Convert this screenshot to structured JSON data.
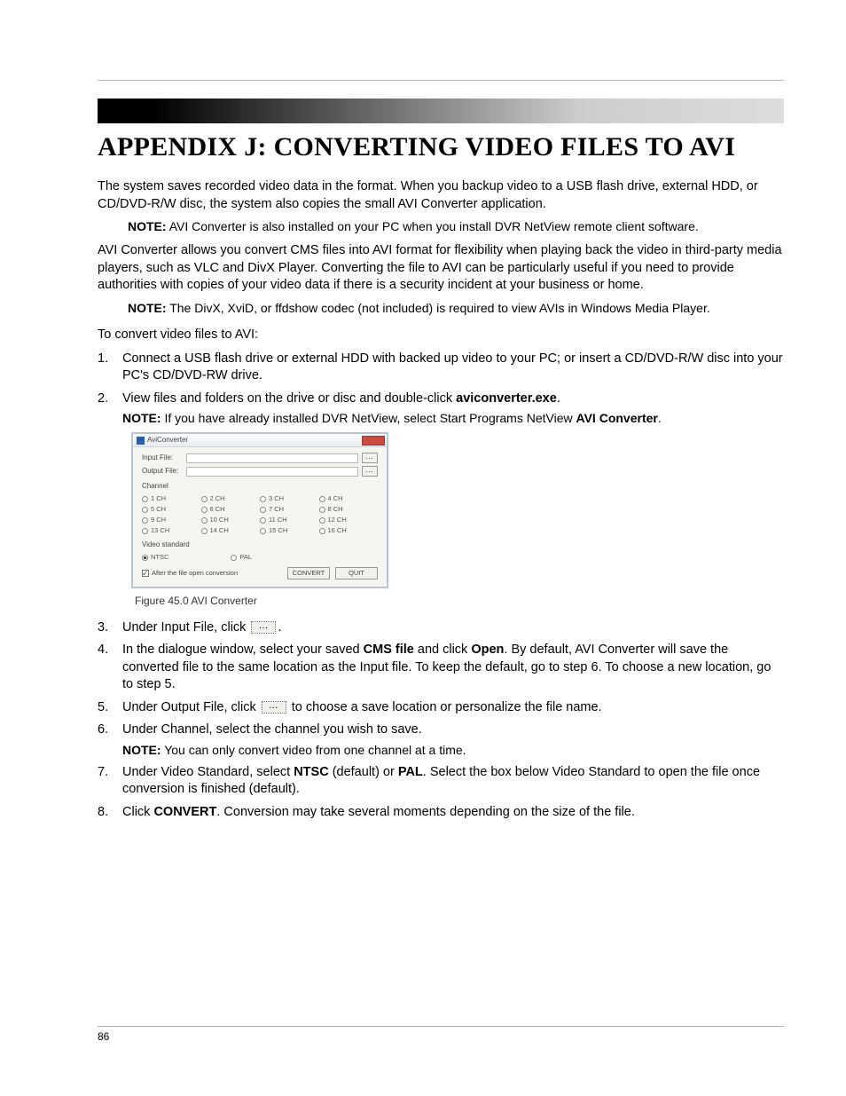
{
  "title": "APPENDIX J: CONVERTING VIDEO FILES TO AVI",
  "intro1": "The system saves recorded video data in the           format. When you backup video to a USB flash drive, external HDD, or CD/DVD-R/W disc, the system also copies the small AVI Converter application.",
  "note1_label": "NOTE:",
  "note1": "AVI Converter is also installed on your PC when you install DVR NetView remote client software.",
  "intro2": "AVI Converter allows you convert CMS files into AVI format for flexibility when playing back the video in third-party media players, such as VLC and DivX Player. Converting the file to AVI can be particularly useful if you need to provide authorities with copies of your video data if there is a security incident at your business or home.",
  "note2_label": "NOTE:",
  "note2": "The DivX, XviD, or ffdshow codec (not included) is required to view AVIs in Windows Media Player.",
  "section_intro": "To convert video files to AVI:",
  "steps": {
    "s1": "Connect a USB flash drive or external HDD with backed up video to your PC; or insert a CD/DVD-R/W disc into your PC's CD/DVD-RW drive.",
    "s2_a": "View files and folders on the drive or disc and double-click ",
    "s2_b": "aviconverter.exe",
    "s2_c": ".",
    "s2_note_label": "NOTE:",
    "s2_note_a": "If you have already installed DVR NetView, select Start",
    "s2_note_b": "Programs",
    "s2_note_c": "NetView",
    "s2_note_d": "AVI Converter",
    "s3_a": "Under Input File, click ",
    "s3_b": ".",
    "s4_a": "In the dialogue window, select your saved ",
    "s4_b": "CMS file",
    "s4_c": " and click ",
    "s4_d": "Open",
    "s4_e": ". By default, AVI Converter will save the converted file to the same location as the Input file. To keep the default, go to step 6. To choose a new location, go to step 5.",
    "s5_a": "Under Output File, click ",
    "s5_b": " to choose a save location or personalize the file name.",
    "s6": "Under Channel, select the channel you wish to save.",
    "s6_note_label": "NOTE:",
    "s6_note": "You can only convert video from one channel at a time.",
    "s7_a": "Under Video Standard, select ",
    "s7_b": "NTSC",
    "s7_c": " (default) or ",
    "s7_d": "PAL",
    "s7_e": ". Select the box below Video Standard to open the file once conversion is finished (default).",
    "s8_a": "Click ",
    "s8_b": "CONVERT",
    "s8_c": ". Conversion may take several moments depending on the size of the file."
  },
  "app": {
    "title": "AviConverter",
    "input_label": "Input File:",
    "output_label": "Output File:",
    "channel_label": "Channel",
    "channels": [
      "1 CH",
      "2 CH",
      "3 CH",
      "4 CH",
      "5 CH",
      "6 CH",
      "7 CH",
      "8 CH",
      "9 CH",
      "10 CH",
      "11 CH",
      "12 CH",
      "13 CH",
      "14 CH",
      "15 CH",
      "16 CH"
    ],
    "vstd_label": "Video standard",
    "ntsc": "NTSC",
    "pal": "PAL",
    "after_open": "After the file open conversion",
    "convert": "CONVERT",
    "quit": "QUIT"
  },
  "figure_caption": "Figure 45.0 AVI Converter",
  "page_number": "86"
}
